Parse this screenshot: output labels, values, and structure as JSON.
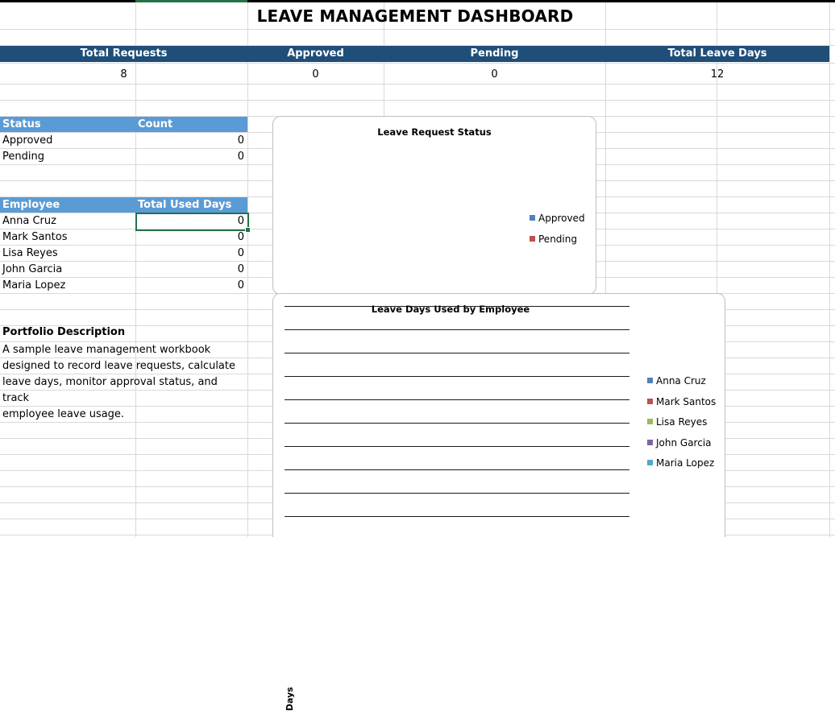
{
  "title": "LEAVE MANAGEMENT DASHBOARD",
  "kpis": [
    {
      "label": "Total Requests",
      "value": "8"
    },
    {
      "label": "Approved",
      "value": "0"
    },
    {
      "label": "Pending",
      "value": "0"
    },
    {
      "label": "Total Leave Days",
      "value": "12"
    }
  ],
  "status_table": {
    "headers": [
      "Status",
      "Count"
    ],
    "rows": [
      {
        "label": "Approved",
        "value": "0"
      },
      {
        "label": "Pending",
        "value": "0"
      }
    ]
  },
  "employee_table": {
    "headers": [
      "Employee",
      "Total Used Days"
    ],
    "rows": [
      {
        "label": "Anna Cruz",
        "value": "0"
      },
      {
        "label": "Mark Santos",
        "value": "0"
      },
      {
        "label": "Lisa Reyes",
        "value": "0"
      },
      {
        "label": "John Garcia",
        "value": "0"
      },
      {
        "label": "Maria Lopez",
        "value": "0"
      }
    ]
  },
  "description": {
    "title": "Portfolio Description",
    "lines": [
      "A sample leave management workbook",
      "designed to record leave requests, calculate",
      "leave days, monitor approval status, and track",
      "employee leave usage."
    ]
  },
  "chart_data": [
    {
      "type": "pie",
      "title": "Leave Request Status",
      "categories": [
        "Approved",
        "Pending"
      ],
      "values": [
        0,
        0
      ],
      "legend": "right",
      "colors": [
        "#4f81bd",
        "#c0504d"
      ]
    },
    {
      "type": "bar",
      "title": "Leave Days Used by Employee",
      "ylabel": "Days",
      "categories": [
        "Anna Cruz",
        "Mark Santos",
        "Lisa Reyes",
        "John Garcia",
        "Maria Lopez"
      ],
      "values": [
        0,
        0,
        0,
        0,
        0
      ],
      "legend": "right",
      "grid": true,
      "colors": [
        "#4f81bd",
        "#c0504d",
        "#9bbb59",
        "#8064a2",
        "#4bacc6"
      ]
    }
  ]
}
